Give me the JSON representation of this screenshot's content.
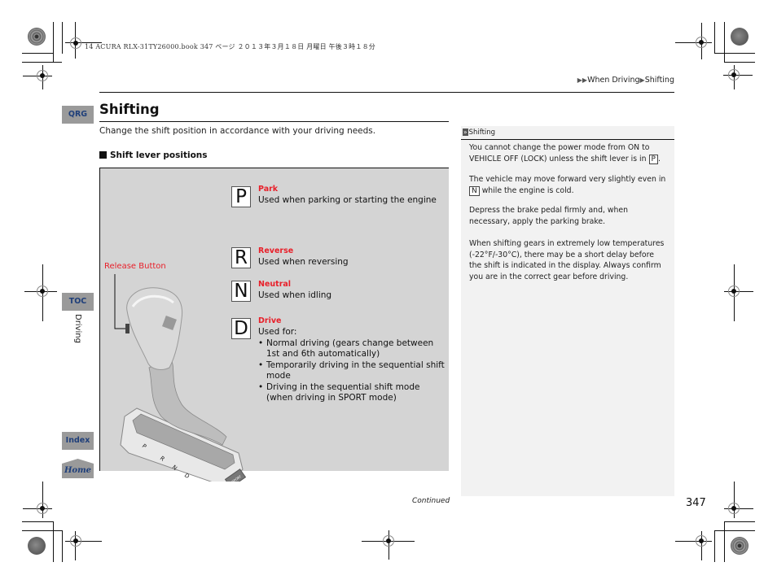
{
  "print_header": "14 ACURA RLX-31TY26000.book  347 ページ  ２０１３年３月１８日  月曜日  午後３時１８分",
  "breadcrumb": {
    "arrow_icon": "double-triangle-right",
    "items": [
      "When Driving",
      "Shifting"
    ]
  },
  "side_tabs": {
    "qrg": "QRG",
    "toc": "TOC",
    "section": "Driving",
    "index": "Index",
    "home": "Home"
  },
  "page": {
    "title": "Shifting",
    "intro": "Change the shift position in accordance with your driving needs.",
    "subheading": "Shift lever positions"
  },
  "figure": {
    "release_label": "Release Button",
    "lever_letters": [
      "P",
      "R",
      "N",
      "D"
    ],
    "sport_button": "SPORT",
    "positions": [
      {
        "letter": "P",
        "name": "Park",
        "desc": "Used when parking or starting the engine"
      },
      {
        "letter": "R",
        "name": "Reverse",
        "desc": "Used when reversing"
      },
      {
        "letter": "N",
        "name": "Neutral",
        "desc": "Used when idling"
      },
      {
        "letter": "D",
        "name": "Drive",
        "desc": "Used for:",
        "bullets": [
          "Normal driving (gears change between 1st and 6th automatically)",
          "Temporarily driving in the sequential shift mode",
          "Driving in the sequential shift mode (when driving in SPORT mode)"
        ]
      }
    ]
  },
  "note": {
    "heading": "Shifting",
    "p1_a": "You cannot change the power mode from ON to VEHICLE OFF (LOCK) unless the shift lever is in",
    "p1_box": "P",
    "p1_b": ".",
    "p2_box": "N",
    "p2_a": "The vehicle may move forward very slightly even in",
    "p2_b": "while the engine is cold.",
    "p3": "Depress the brake pedal firmly and, when necessary, apply the parking brake.",
    "p4": "When shifting gears in extremely low temperatures (-22°F/-30°C), there may be a short delay before the shift is indicated in the display. Always confirm you are in the correct gear before driving."
  },
  "footer": {
    "continued": "Continued",
    "page_number": "347"
  },
  "colors": {
    "accent_red": "#e8202a",
    "tab_text_blue": "#1f3f7a",
    "tab_gray": "#9a9a9a",
    "figure_bg": "#d4d4d4",
    "note_bg": "#f2f2f2"
  }
}
